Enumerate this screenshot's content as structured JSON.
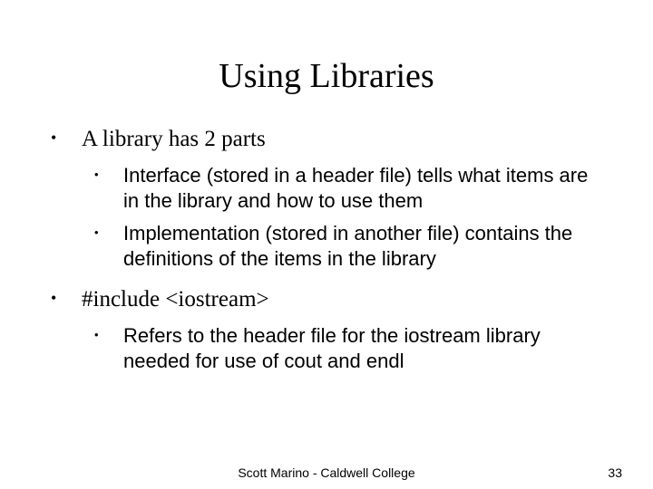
{
  "title": "Using Libraries",
  "bullets": {
    "b1": {
      "text": "A library has 2 parts",
      "sub": {
        "s1": "Interface (stored in a header file) tells what items are in the library and how to use them",
        "s2": "Implementation (stored in another file) contains the definitions of the items in the library"
      }
    },
    "b2": {
      "text": "#include <iostream>",
      "sub": {
        "s1": "Refers to the header file for the iostream library needed for use of cout and endl"
      }
    }
  },
  "footer": {
    "center": "Scott Marino - Caldwell College",
    "page": "33"
  }
}
